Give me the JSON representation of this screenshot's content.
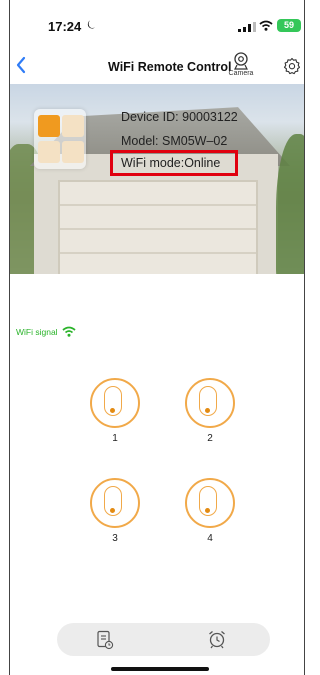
{
  "status_bar": {
    "time": "17:24",
    "battery": "59"
  },
  "nav": {
    "title": "WiFi Remote Control",
    "camera_label": "Camera"
  },
  "device": {
    "device_id": "Device ID: 90003122",
    "model": "Model: SM05W–02",
    "wifi_mode": "WiFi mode:Online"
  },
  "wifi_signal": {
    "label": "WiFi signal",
    "color": "#2ab32a"
  },
  "remote_buttons": [
    {
      "label": "1"
    },
    {
      "label": "2"
    },
    {
      "label": "3"
    },
    {
      "label": "4"
    }
  ],
  "colors": {
    "accent": "#f1a949",
    "highlight_box": "#e0000f",
    "battery": "#34c759"
  },
  "icons": {
    "back": "chevron-left-icon",
    "camera": "camera-icon",
    "settings": "gear-icon",
    "log": "log-icon",
    "alarm": "alarm-clock-icon"
  }
}
